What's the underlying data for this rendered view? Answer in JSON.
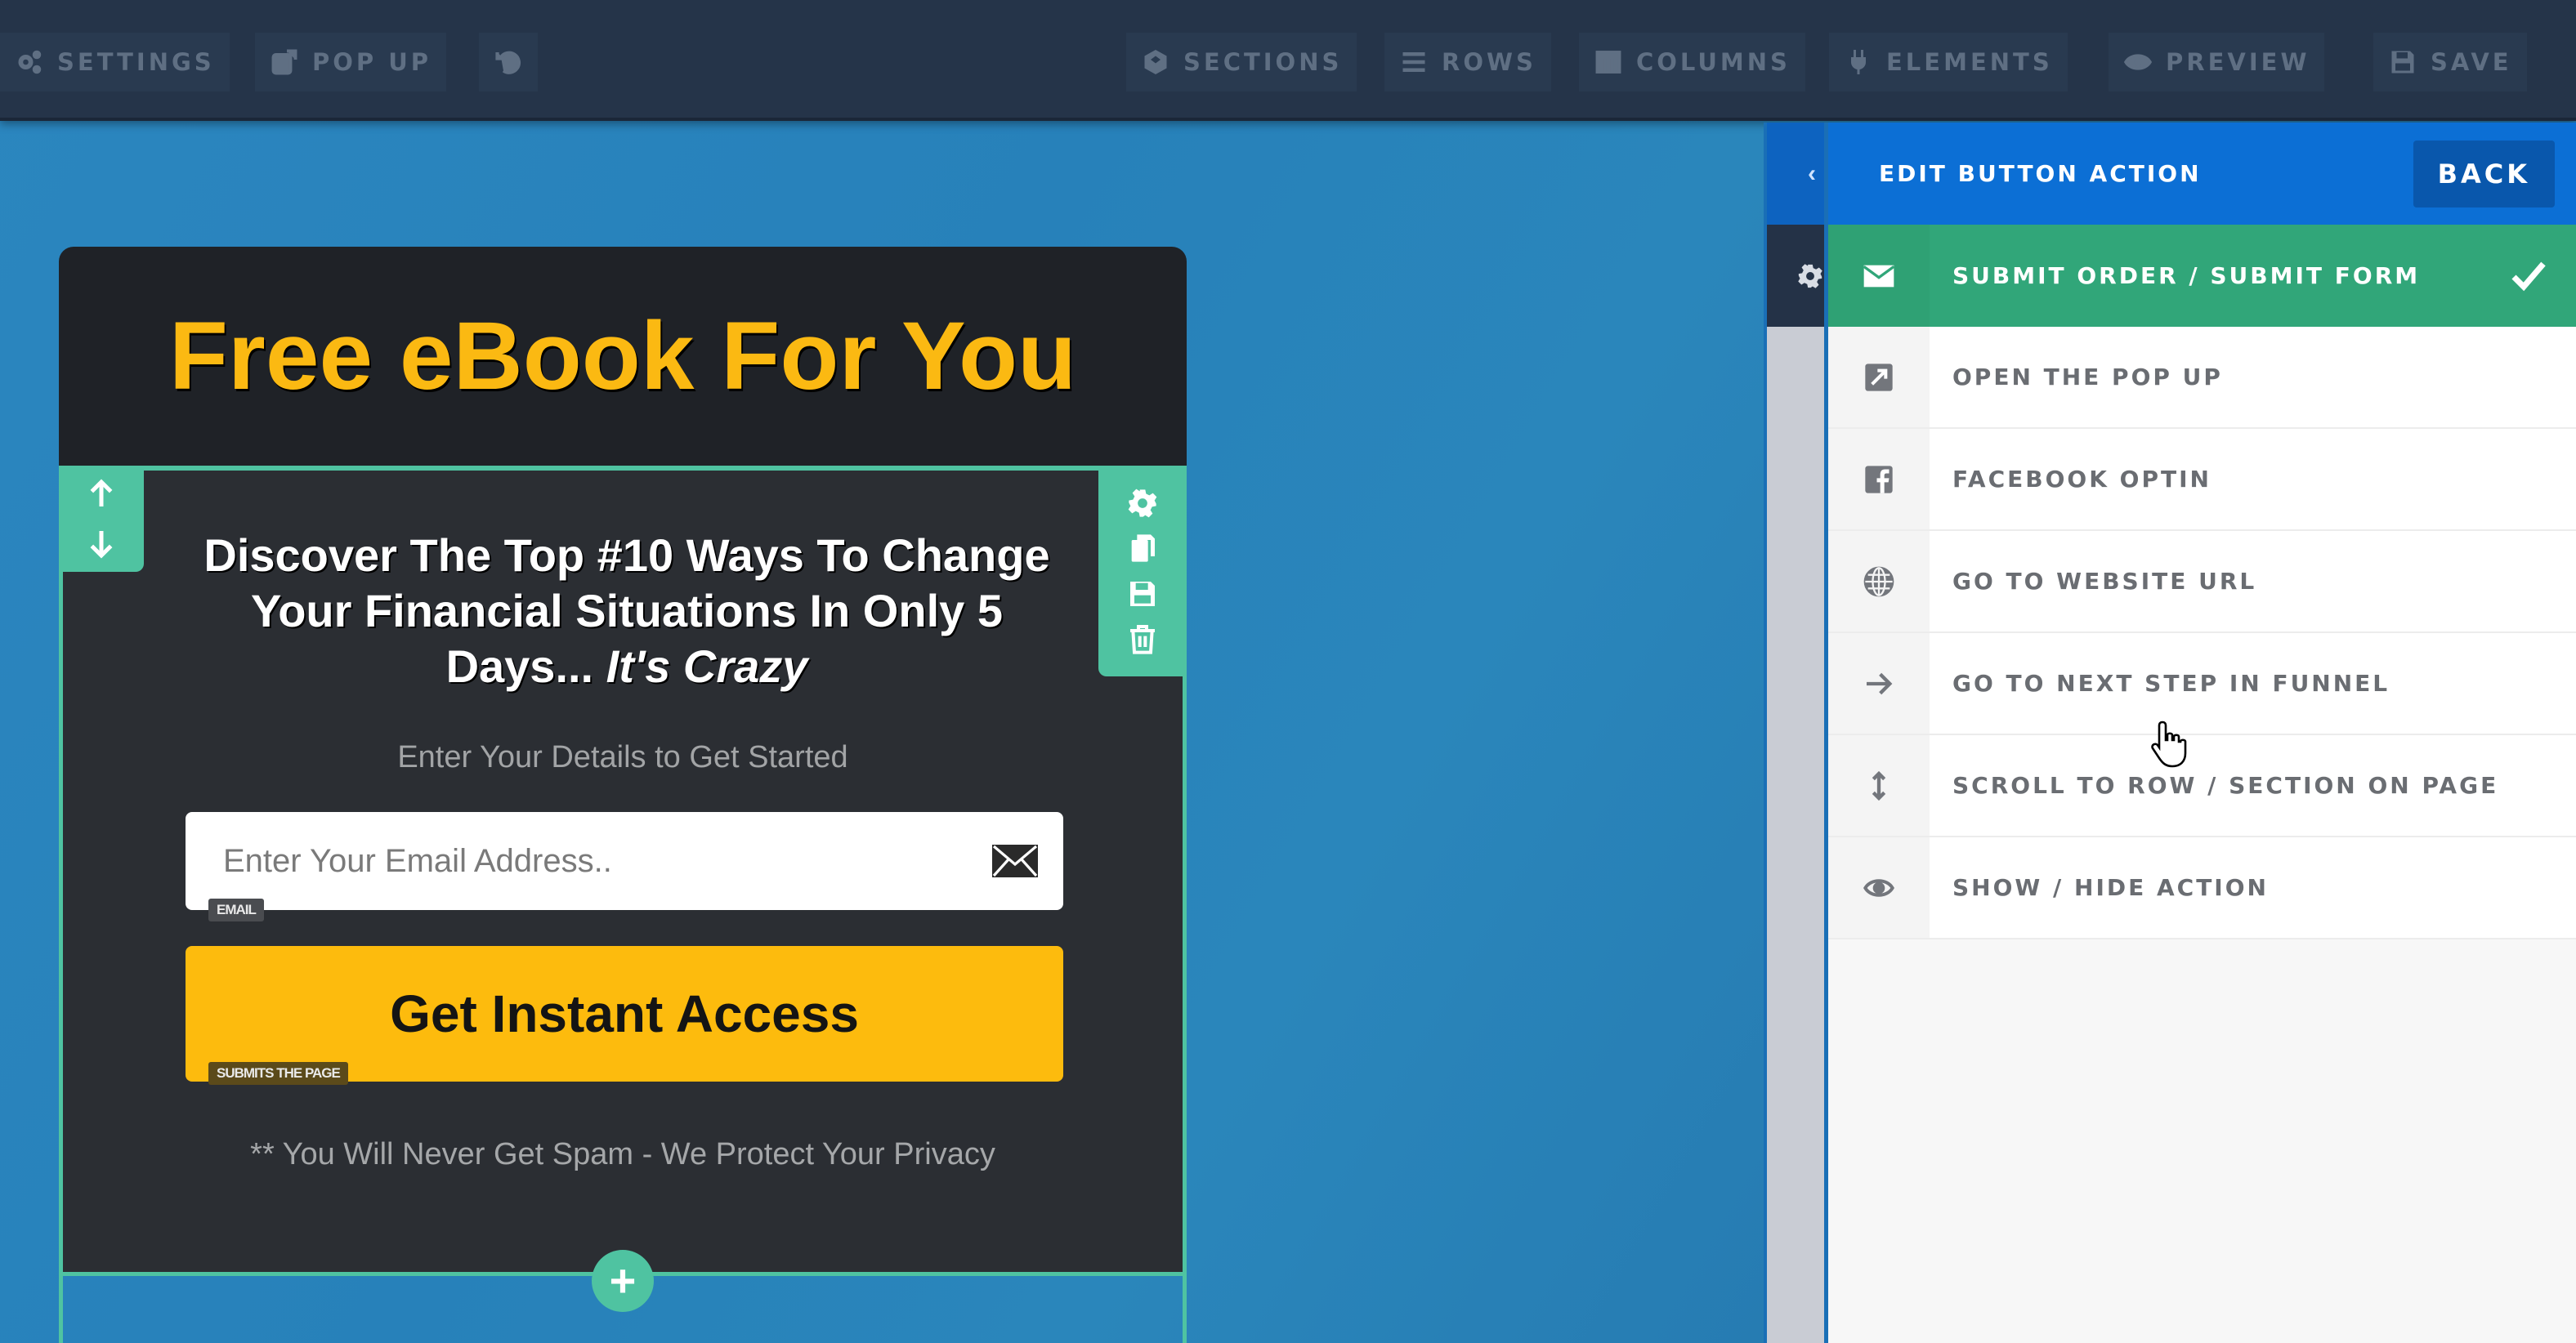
{
  "toolbar": {
    "left": [
      {
        "label": "SETTINGS",
        "icon": "gears-icon"
      },
      {
        "label": "POP UP",
        "icon": "external-edit-icon"
      },
      {
        "label": "",
        "icon": "undo-icon"
      }
    ],
    "right": [
      {
        "label": "SECTIONS",
        "icon": "cube-icon"
      },
      {
        "label": "ROWS",
        "icon": "rows-icon"
      },
      {
        "label": "COLUMNS",
        "icon": "columns-icon"
      },
      {
        "label": "ELEMENTS",
        "icon": "plug-icon"
      },
      {
        "label": "PREVIEW",
        "icon": "eye-icon"
      },
      {
        "label": "SAVE",
        "icon": "floppy-icon"
      }
    ]
  },
  "canvas": {
    "title": "Free eBook For You",
    "headline_main": "Discover The Top #10 Ways To Change Your Financial Situations In Only 5 Days... ",
    "headline_italic": "It's Crazy",
    "subtext": "Enter Your Details to Get Started",
    "email_placeholder": "Enter Your Email Address..",
    "email_tag": "EMAIL",
    "cta_label": "Get Instant Access",
    "cta_tag": "SUBMITS THE PAGE",
    "privacy": "** You Will Never Get Spam - We Protect Your Privacy",
    "add_row_label": "+"
  },
  "panel": {
    "title": "EDIT BUTTON ACTION",
    "back_label": "BACK",
    "actions": [
      {
        "label": "SUBMIT ORDER / SUBMIT FORM",
        "icon": "envelope-icon",
        "selected": true
      },
      {
        "label": "OPEN THE POP UP",
        "icon": "external-link-icon",
        "selected": false
      },
      {
        "label": "FACEBOOK OPTIN",
        "icon": "facebook-icon",
        "selected": false
      },
      {
        "label": "GO TO WEBSITE URL",
        "icon": "globe-icon",
        "selected": false
      },
      {
        "label": "GO TO NEXT STEP IN FUNNEL",
        "icon": "arrow-right-icon",
        "selected": false
      },
      {
        "label": "SCROLL TO ROW / SECTION ON PAGE",
        "icon": "vertical-arrows-icon",
        "selected": false
      },
      {
        "label": "SHOW / HIDE ACTION",
        "icon": "eye-icon",
        "selected": false
      }
    ]
  },
  "colors": {
    "toolbar_bg": "#253449",
    "canvas_bg": "#2781ba",
    "title_yellow": "#fbb912",
    "teal": "#4fc3a1",
    "cta_yellow": "#fdbb0d",
    "panel_header_blue": "#0c6fd5",
    "selected_green": "#31a679"
  }
}
